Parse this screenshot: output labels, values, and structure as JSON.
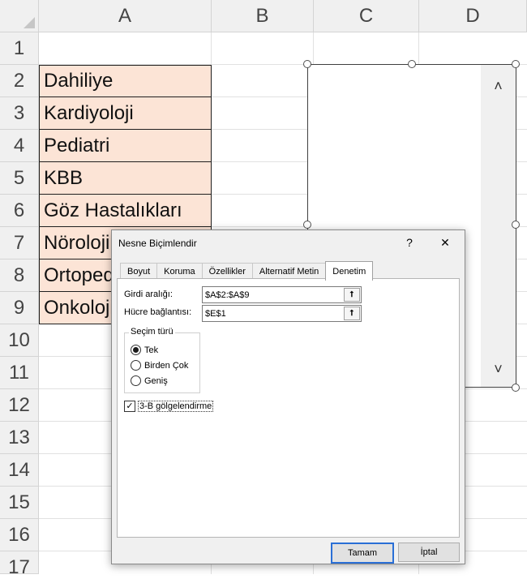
{
  "columns": [
    "A",
    "B",
    "C",
    "D"
  ],
  "rows": [
    "1",
    "2",
    "3",
    "4",
    "5",
    "6",
    "7",
    "8",
    "9",
    "10",
    "11",
    "12",
    "13",
    "14",
    "15",
    "16",
    "17"
  ],
  "cells_a": [
    "Dahiliye",
    "Kardiyoloji",
    "Pediatri",
    "KBB",
    "Göz Hastalıkları",
    "Nöroloji",
    "Ortopedi",
    "Onkoloji"
  ],
  "listbox": {
    "scroll_up": "˄",
    "scroll_down": "˅"
  },
  "dialog": {
    "title": "Nesne Biçimlendir",
    "help": "?",
    "close": "✕",
    "tabs": [
      "Boyut",
      "Koruma",
      "Özellikler",
      "Alternatif Metin",
      "Denetim"
    ],
    "active_tab": "Denetim",
    "input_range_label": "Girdi aralığı:",
    "input_range_value": "$A$2:$A$9",
    "cell_link_label": "Hücre bağlantısı:",
    "cell_link_value": "$E$1",
    "ref_button": "⭡",
    "selection_group": "Seçim türü",
    "selection_options": [
      "Tek",
      "Birden Çok",
      "Geniş"
    ],
    "selected_option": "Tek",
    "shading_label": "3-B gölgelendirme",
    "shading_checked": true,
    "ok": "Tamam",
    "cancel": "İptal"
  }
}
